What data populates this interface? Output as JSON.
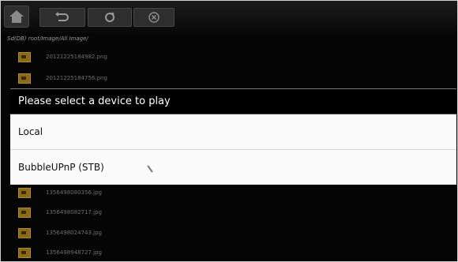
{
  "toolbar": {
    "buttons": [
      {
        "icon": "home-icon"
      },
      {
        "icon": "back-icon"
      },
      {
        "icon": "refresh-icon"
      },
      {
        "icon": "close-icon"
      }
    ]
  },
  "path": "Sd(DB) root/Image/All Image/",
  "files": [
    "20121225184982.png",
    "20121225184756.png",
    "1356498080356.jpg",
    "1356498082717.jpg",
    "1356498024743.jpg",
    "1356498948727.jpg"
  ],
  "dialog": {
    "title": "Please select a device to play",
    "options": [
      "Local",
      "BubbleUPnP (STB)"
    ]
  }
}
